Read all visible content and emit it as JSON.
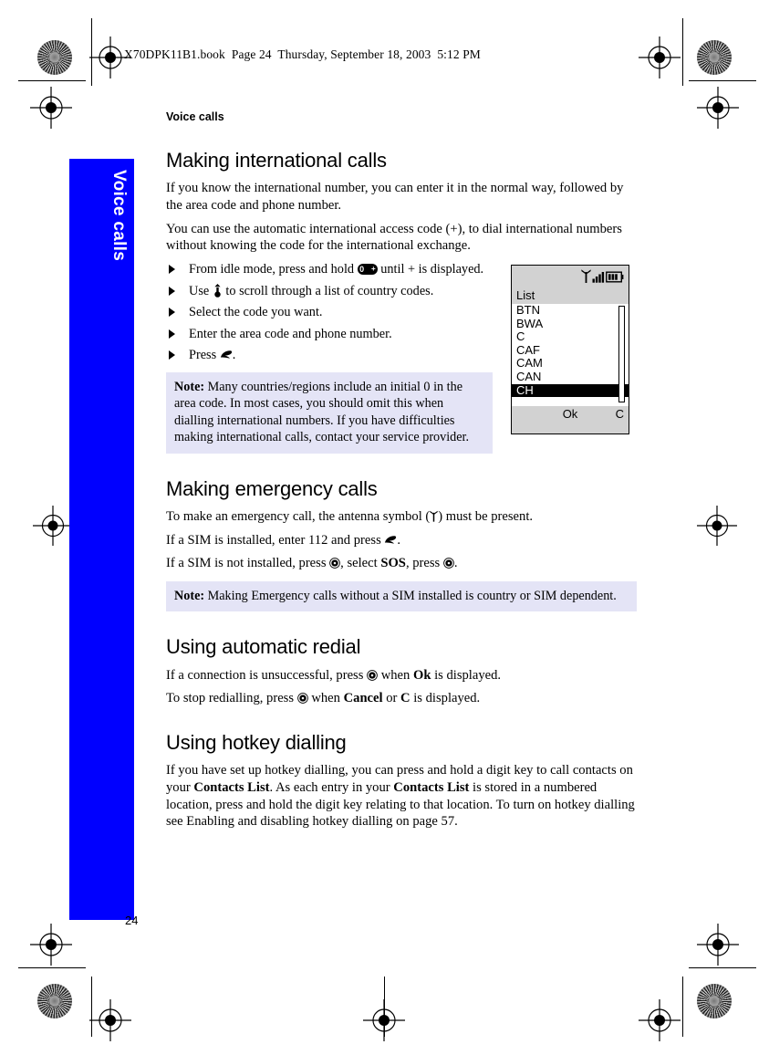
{
  "document": {
    "header_line": "X70DPK11B1.book  Page 24  Thursday, September 18, 2003  5:12 PM",
    "running_head": "Voice calls",
    "side_tab_label": "Voice calls",
    "page_number": "24"
  },
  "sections": {
    "international": {
      "heading": "Making international calls",
      "para1": "If you know the international number, you can enter it in the normal way, followed by the area code and phone number.",
      "para2": "You can use the automatic international access code (+), to dial international numbers without knowing the code for the international exchange.",
      "steps": [
        {
          "before": "From idle mode, press and hold ",
          "icon": "key-zero-plus-icon",
          "after": " until + is displayed."
        },
        {
          "before": "Use ",
          "icon": "navigation-key-icon",
          "after": " to scroll through a list of country codes."
        },
        {
          "before": "Select the code you want.",
          "icon": "",
          "after": ""
        },
        {
          "before": "Enter the area code and phone number.",
          "icon": "",
          "after": ""
        },
        {
          "before": "Press ",
          "icon": "send-key-icon",
          "after": "."
        }
      ],
      "note_label": "Note:",
      "note_text": "Many countries/regions include an initial 0 in the area code. In most cases, you should omit this when dialling international numbers. If you have difficulties making international calls, contact your service provider."
    },
    "emergency": {
      "heading": "Making emergency calls",
      "line1_before": "To make an emergency call, the antenna symbol (",
      "line1_icon": "antenna-icon",
      "line1_after": ") must be present.",
      "line2_before": "If a SIM is installed, enter 112 and press ",
      "line2_icon": "send-key-icon",
      "line2_after": ".",
      "line3_a": "If a SIM is not installed, press ",
      "line3_icon1": "softkey-icon",
      "line3_b": ",  select ",
      "line3_bold": "SOS",
      "line3_c": ", press ",
      "line3_icon2": "softkey-icon",
      "line3_d": ".",
      "note_label": "Note:",
      "note_text": "Making Emergency calls without a SIM installed is country or SIM dependent."
    },
    "redial": {
      "heading": "Using automatic redial",
      "line1_a": "If a connection is unsuccessful, press ",
      "line1_icon": "softkey-icon",
      "line1_b": " when ",
      "line1_bold": "Ok",
      "line1_c": " is displayed.",
      "line2_a": "To stop redialling, press ",
      "line2_icon": "softkey-icon",
      "line2_b": " when ",
      "line2_bold1": "Cancel",
      "line2_c": " or ",
      "line2_bold2": "C",
      "line2_d": " is displayed."
    },
    "hotkey": {
      "heading": "Using hotkey dialling",
      "para_a": "If you have set up hotkey dialling, you can press and hold a digit key to call contacts on your ",
      "para_bold1": "Contacts List",
      "para_b": ". As each entry in your ",
      "para_bold2": "Contacts List",
      "para_c": " is stored in a numbered location, press and hold the digit key relating to that location. To turn on hotkey dialling see Enabling and disabling hotkey dialling on page 57."
    }
  },
  "phone_screen": {
    "status_icons": [
      "antenna-icon",
      "signal-bars-icon",
      "battery-icon"
    ],
    "title": "List",
    "items": [
      "BTN",
      "BWA",
      "C",
      "CAF",
      "CAM",
      "CAN",
      "CH"
    ],
    "selected_item": "CH",
    "softkey_left": "Ok",
    "softkey_right": "C"
  },
  "colors": {
    "tab_blue": "#0000ff",
    "note_background": "#e4e4f6",
    "screen_gray": "#d2d2d2"
  }
}
